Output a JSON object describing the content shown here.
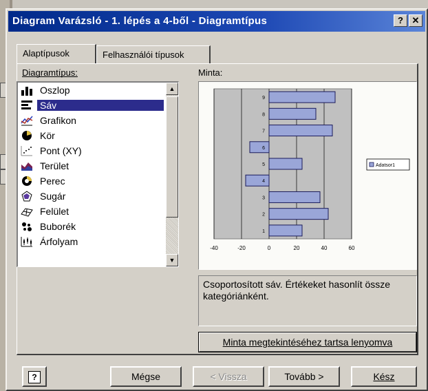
{
  "window": {
    "title": "Diagram Varázsló - 1. lépés a 4-ből - Diagramtípus",
    "help_glyph": "?",
    "close_glyph": "✕"
  },
  "tabs": [
    {
      "label": "Alaptípusok"
    },
    {
      "label": "Felhasználói típusok"
    }
  ],
  "chart_type_label": "Diagramtípus:",
  "sample_label": "Minta:",
  "chart_types": [
    {
      "label": "Oszlop",
      "icon": "column-chart-icon"
    },
    {
      "label": "Sáv",
      "icon": "bar-chart-icon",
      "selected": true
    },
    {
      "label": "Grafikon",
      "icon": "line-chart-icon"
    },
    {
      "label": "Kör",
      "icon": "pie-chart-icon"
    },
    {
      "label": "Pont (XY)",
      "icon": "scatter-chart-icon"
    },
    {
      "label": "Terület",
      "icon": "area-chart-icon"
    },
    {
      "label": "Perec",
      "icon": "doughnut-chart-icon"
    },
    {
      "label": "Sugár",
      "icon": "radar-chart-icon"
    },
    {
      "label": "Felület",
      "icon": "surface-chart-icon"
    },
    {
      "label": "Buborék",
      "icon": "bubble-chart-icon"
    },
    {
      "label": "Árfolyam",
      "icon": "stock-chart-icon"
    }
  ],
  "description": "Csoportosított sáv. Értékeket hasonlít össze kategóriánként.",
  "preview_button": "Minta megtekintéséhez tartsa lenyomva",
  "buttons": {
    "help": "?",
    "cancel": "Mégse",
    "back": "< Vissza",
    "next": "Tovább >",
    "finish": "Kész"
  },
  "chart_data": {
    "type": "bar",
    "orientation": "horizontal",
    "categories": [
      "1",
      "2",
      "3",
      "4",
      "5",
      "6",
      "7",
      "8",
      "9"
    ],
    "series": [
      {
        "name": "Adatsor1",
        "values": [
          24,
          43,
          37,
          -17,
          24,
          -14,
          46,
          34,
          48
        ]
      }
    ],
    "xlim": [
      -40,
      60
    ],
    "xticks": [
      "-40",
      "-20",
      "0",
      "20",
      "40",
      "60"
    ],
    "grid": true,
    "legend": "right",
    "bar_color": "#9aa6d8",
    "plot_color": "#c0c0c0"
  }
}
